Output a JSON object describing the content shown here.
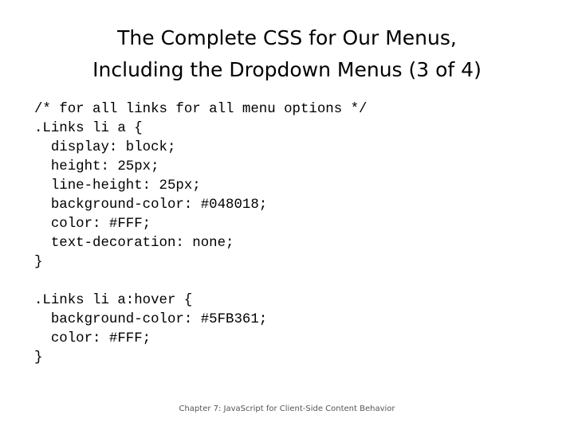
{
  "slide": {
    "title_lines": [
      "The Complete CSS for Our Menus,",
      "Including the Dropdown Menus (3 of 4)"
    ],
    "code_lines": [
      "/* for all links for all menu options */",
      ".Links li a {",
      "  display: block;",
      "  height: 25px;",
      "  line-height: 25px;",
      "  background-color: #048018;",
      "  color: #FFF;",
      "  text-decoration: none;",
      "}",
      "",
      ".Links li a:hover {",
      "  background-color: #5FB361;",
      "  color: #FFF;",
      "}"
    ],
    "footer": "Chapter 7: JavaScript for Client-Side Content Behavior"
  }
}
